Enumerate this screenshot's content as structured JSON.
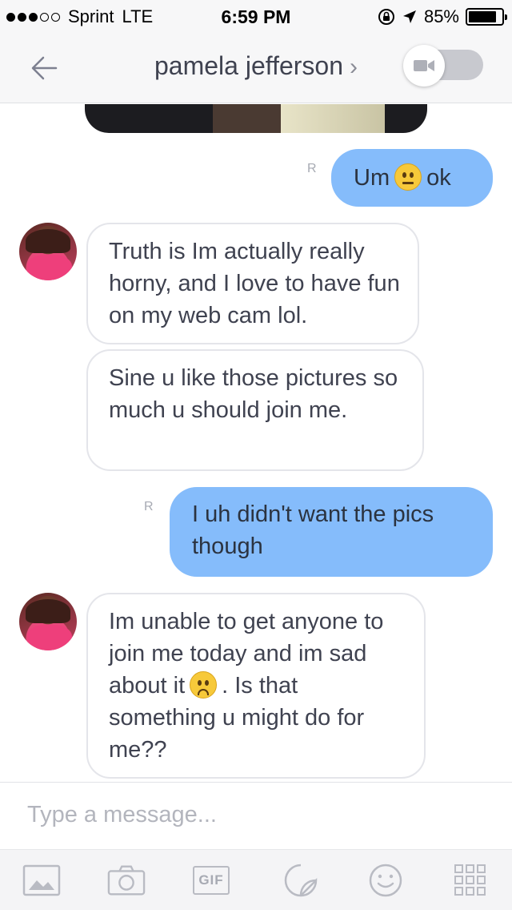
{
  "status_bar": {
    "carrier": "Sprint",
    "network": "LTE",
    "time": "6:59 PM",
    "battery": "85%",
    "battery_level": 0.85,
    "signal_bars": 3
  },
  "nav": {
    "contact_name": "pamela jefferson",
    "chevron": "›"
  },
  "messages": [
    {
      "direction": "outgoing",
      "text_before": "Um",
      "emoji": "neutral-face",
      "text_after": "ok",
      "read_receipt": "R"
    },
    {
      "direction": "incoming",
      "text": "Truth is Im actually really horny, and I love to have fun on my web cam lol."
    },
    {
      "direction": "incoming",
      "text": "Sine u like those pictures so much u should join me."
    },
    {
      "direction": "outgoing",
      "text": "I uh didn't want the pics though",
      "read_receipt": "R"
    },
    {
      "direction": "incoming",
      "text_before": "Im unable to get anyone to join me today and im sad about it",
      "emoji": "worried-face",
      "text_after": ". Is that something u might do for me??"
    }
  ],
  "composer": {
    "placeholder": "Type a message..."
  },
  "toolbar": {
    "gif_label": "GIF",
    "icons": [
      "gallery-icon",
      "camera-icon",
      "gif-icon",
      "sticker-icon",
      "smiley-icon",
      "apps-grid-icon"
    ]
  },
  "colors": {
    "outgoing_bubble": "#85bcfb",
    "incoming_border": "#e4e5ea",
    "text": "#3f4250"
  }
}
